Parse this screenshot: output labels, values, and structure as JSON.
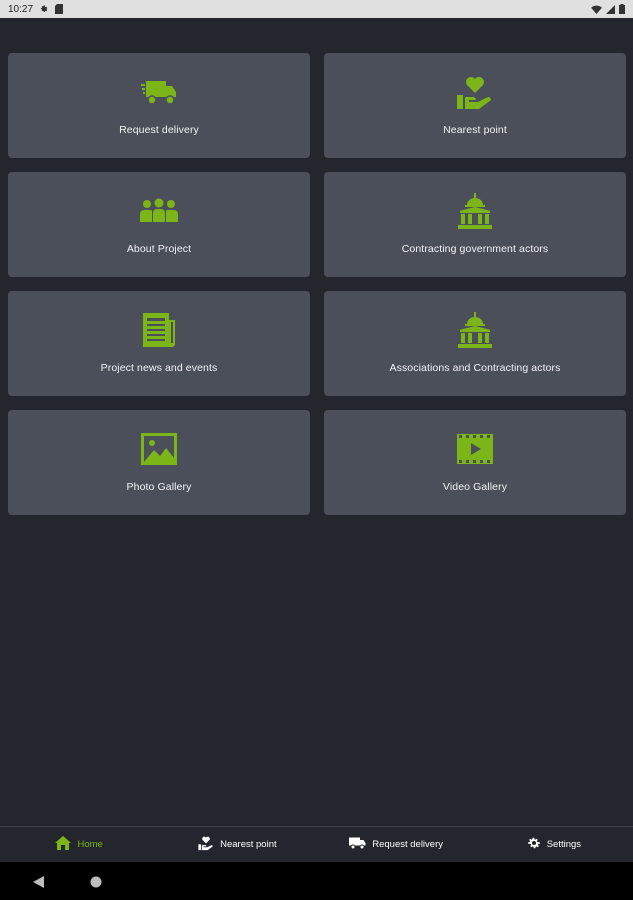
{
  "status_bar": {
    "time": "10:27"
  },
  "colors": {
    "accent": "#7cb518",
    "tile_bg": "#4b4f5a",
    "background": "#23262d"
  },
  "tiles": [
    {
      "label": "Request delivery",
      "icon": "delivery-truck-icon"
    },
    {
      "label": "Nearest point",
      "icon": "heart-hand-icon"
    },
    {
      "label": "About Project",
      "icon": "group-icon"
    },
    {
      "label": "Contracting government actors",
      "icon": "government-building-icon"
    },
    {
      "label": "Project news and events",
      "icon": "newspaper-icon"
    },
    {
      "label": "Associations and Contracting actors",
      "icon": "association-building-icon"
    },
    {
      "label": "Photo Gallery",
      "icon": "image-icon"
    },
    {
      "label": "Video Gallery",
      "icon": "video-icon"
    }
  ],
  "bottom_nav": {
    "items": [
      {
        "label": "Home",
        "icon": "home-icon",
        "active": true
      },
      {
        "label": "Nearest point",
        "icon": "heart-hand-icon",
        "active": false
      },
      {
        "label": "Request delivery",
        "icon": "delivery-truck-icon",
        "active": false
      },
      {
        "label": "Settings",
        "icon": "gear-icon",
        "active": false
      }
    ]
  }
}
